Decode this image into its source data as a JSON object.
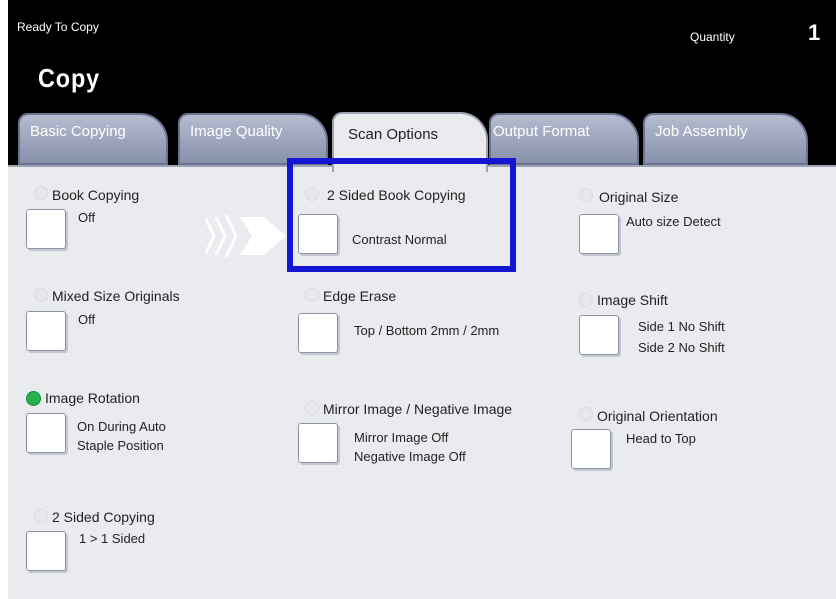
{
  "status": "Ready To Copy",
  "quantity": {
    "label": "Quantity",
    "value": "1"
  },
  "title": "Copy",
  "tabs": [
    "Basic Copying",
    "Image Quality",
    "Scan Options",
    "Output Format",
    "Job Assembly"
  ],
  "options": {
    "book_copying": {
      "label": "Book Copying",
      "value": "Off"
    },
    "two_sided_book": {
      "label": "2 Sided Book Copying",
      "value": "Contrast Normal"
    },
    "original_size": {
      "label": "Original Size",
      "value": "Auto size Detect"
    },
    "mixed_size": {
      "label": "Mixed Size Originals",
      "value": "Off"
    },
    "edge_erase": {
      "label": "Edge Erase",
      "value": "Top / Bottom 2mm / 2mm"
    },
    "image_shift": {
      "label": "Image Shift",
      "value1": "Side 1 No Shift",
      "value2": "Side 2 No Shift"
    },
    "image_rotation": {
      "label": "Image Rotation",
      "value1": "On During Auto",
      "value2": "Staple Position"
    },
    "mirror_image": {
      "label": "Mirror Image / Negative Image",
      "value1": "Mirror Image Off",
      "value2": "Negative Image Off"
    },
    "orientation": {
      "label": "Original Orientation",
      "value": "Head to Top"
    },
    "two_sided": {
      "label": "2 Sided Copying",
      "value": "1 > 1 Sided"
    }
  },
  "colors": {
    "highlight": "#1515d4",
    "active_indicator": "#23b34a"
  }
}
